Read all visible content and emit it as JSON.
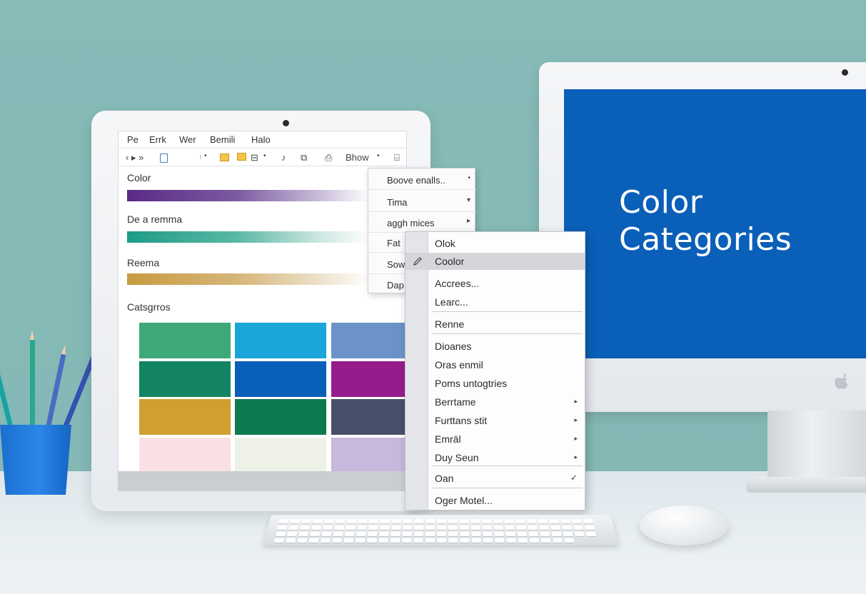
{
  "right_monitor": {
    "title_line1": "Color",
    "title_line2": "Categories",
    "screen_color": "#0a5fb8"
  },
  "app": {
    "menubar": [
      "Pe",
      "Errk",
      "Wer",
      "Bemili",
      "Halo"
    ],
    "toolbar": {
      "nav": "‹ ▸ »",
      "show_label": "Bhow",
      "icons": [
        "back-icon",
        "forward-icon",
        "document-icon",
        "pin-icon",
        "copy-icon",
        "folder-icon",
        "save-icon",
        "brush-icon",
        "image-icon",
        "print-icon",
        "settings-icon"
      ]
    },
    "color_label": "Color",
    "bars": [
      {
        "label": "De a remma",
        "color": "#1d9c86"
      },
      {
        "label": "Reema",
        "color": "#c79b3f"
      }
    ],
    "color_bar": "#5a2a86",
    "categories_label": "Catsgrros",
    "swatches": [
      [
        "#3fa878",
        "#1aa6d9",
        "#6b93c8"
      ],
      [
        "#138463",
        "#0a5fb8",
        "#961c8e"
      ],
      [
        "#cfa030",
        "#0c7a4e",
        "#484f68"
      ],
      [
        "#fae0e3",
        "#eef1e6",
        "#c7b8dc"
      ]
    ]
  },
  "menu1": {
    "items": [
      {
        "label": "Boove enalls..",
        "arrow": "•"
      },
      {
        "label": "Tima",
        "arrow": "▾"
      },
      {
        "label": "aggh mices",
        "arrow": "▸"
      },
      {
        "label": "Fat",
        "arrow": ""
      },
      {
        "label": "Sow",
        "arrow": ""
      },
      {
        "label": "Dap",
        "arrow": ""
      }
    ]
  },
  "menu2": {
    "items": [
      {
        "label": "Olok",
        "arrow": ""
      },
      {
        "label": "Coolor",
        "arrow": ""
      },
      {
        "label": "Accrees...",
        "arrow": ""
      },
      {
        "label": "Learc...",
        "arrow": ""
      },
      {
        "label": "Renne",
        "arrow": ""
      },
      {
        "label": "Dioanes",
        "arrow": ""
      },
      {
        "label": "Oras enmil",
        "arrow": ""
      },
      {
        "label": "Poms untogtries",
        "arrow": ""
      },
      {
        "label": "Berrtame",
        "arrow": "▸"
      },
      {
        "label": "Furttans stit",
        "arrow": "▸"
      },
      {
        "label": "Emrāl",
        "arrow": "▸"
      },
      {
        "label": "Duy Seun",
        "arrow": "▸"
      },
      {
        "label": "Oan",
        "arrow": "✓"
      },
      {
        "label": "Oger Motel...",
        "arrow": ""
      }
    ]
  }
}
